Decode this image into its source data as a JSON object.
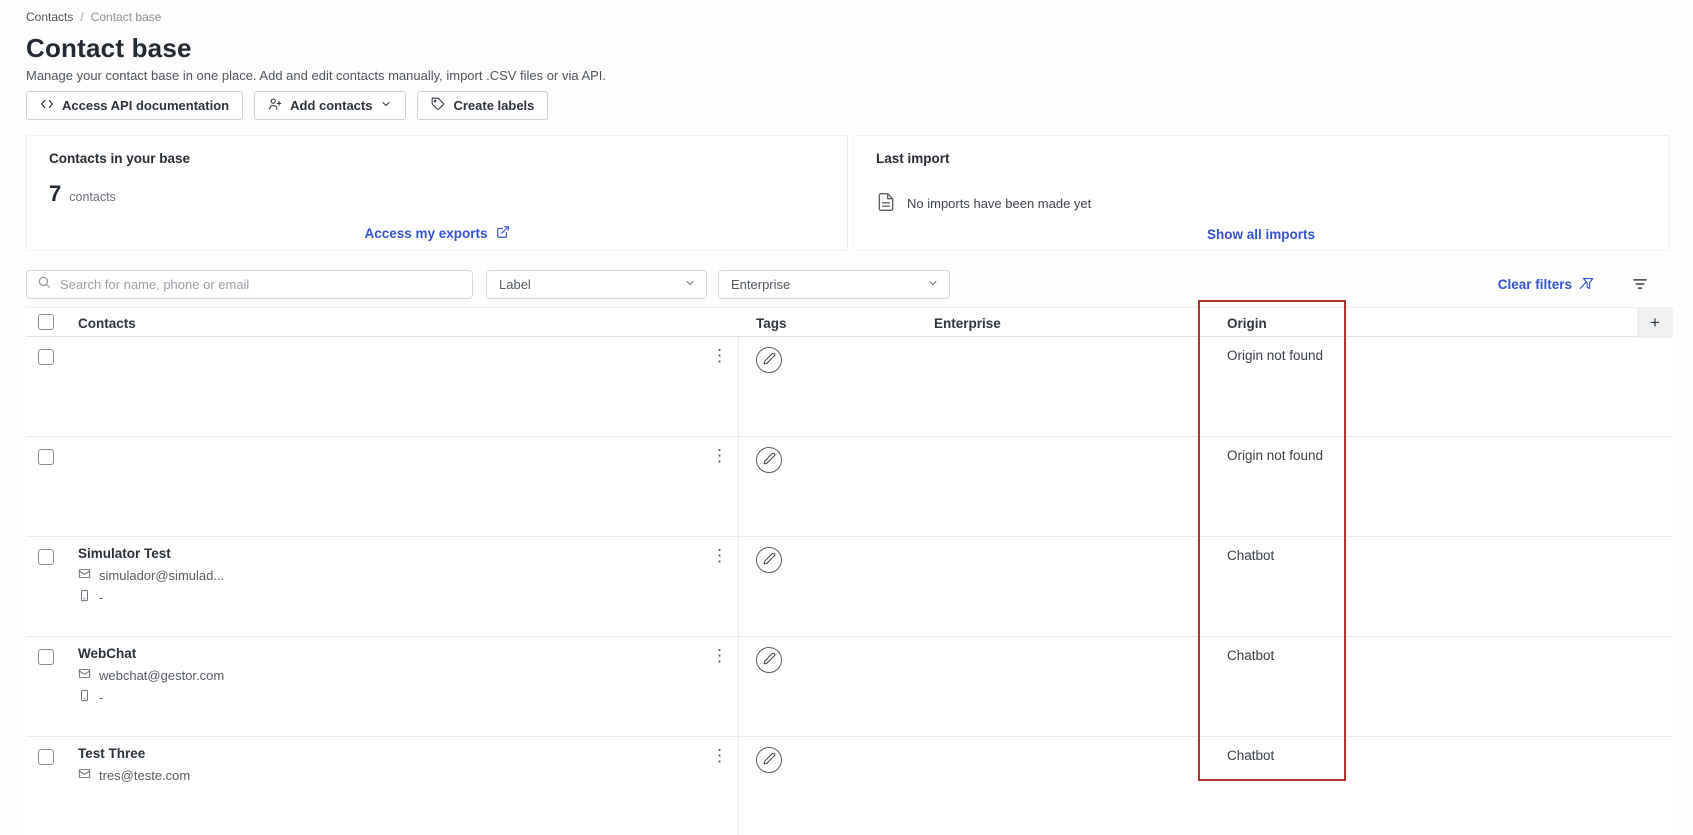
{
  "colors": {
    "link_blue": "#3554d1",
    "annotation_red": "#b0352c"
  },
  "breadcrumb": {
    "contacts": "Contacts",
    "separator": "/",
    "current": "Contact base"
  },
  "header": {
    "title": "Contact base",
    "subtitle": "Manage your contact base in one place. Add and edit contacts manually, import .CSV files or via API."
  },
  "toolbar": {
    "api_docs": "Access API documentation",
    "add_contacts": "Add contacts",
    "create_labels": "Create labels"
  },
  "cards": {
    "contacts": {
      "title": "Contacts in your base",
      "count": "7",
      "unit": "contacts",
      "link": "Access my exports"
    },
    "import": {
      "title": "Last import",
      "empty": "No imports have been made yet",
      "link": "Show all imports"
    }
  },
  "filters": {
    "search_placeholder": "Search for name, phone or email",
    "label": "Label",
    "enterprise": "Enterprise",
    "clear": "Clear filters"
  },
  "table": {
    "headers": {
      "contacts": "Contacts",
      "tags": "Tags",
      "enterprise": "Enterprise",
      "origin": "Origin",
      "add": "+"
    },
    "rows": [
      {
        "name": "",
        "email": "",
        "phone": "",
        "origin": "Origin not found"
      },
      {
        "name": "",
        "email": "",
        "phone": "",
        "origin": "Origin not found"
      },
      {
        "name": "Simulator Test",
        "email": "simulador@simulad...",
        "phone": "-",
        "origin": "Chatbot"
      },
      {
        "name": "WebChat",
        "email": "webchat@gestor.com",
        "phone": "-",
        "origin": "Chatbot"
      },
      {
        "name": "Test Three",
        "email": "tres@teste.com",
        "phone": "",
        "origin": "Chatbot"
      }
    ]
  }
}
